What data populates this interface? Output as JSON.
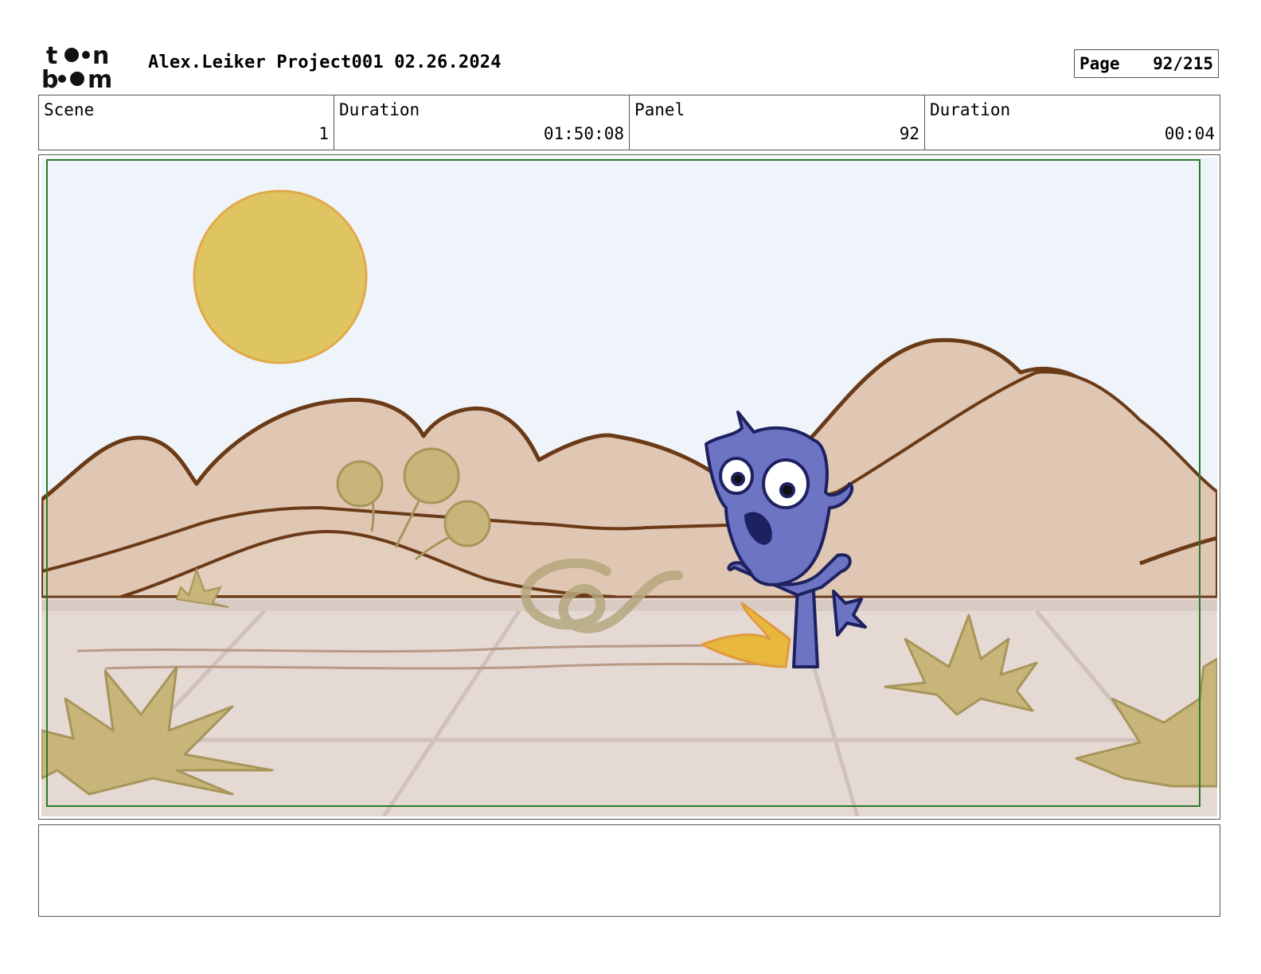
{
  "header": {
    "title": "Alex.Leiker Project001 02.26.2024",
    "page_label": "Page",
    "page_value": "92/215"
  },
  "logo": {
    "icon": "toon-boom-logo",
    "text_line1": "toon",
    "text_line2": "boom"
  },
  "info": {
    "scene_label": "Scene",
    "scene_value": "1",
    "scene_duration_label": "Duration",
    "scene_duration_value": "01:50:08",
    "panel_label": "Panel",
    "panel_value": "92",
    "panel_duration_label": "Duration",
    "panel_duration_value": "00:04"
  },
  "colors": {
    "sky": "#eef4fa",
    "sun": "#dfc462",
    "hills": "#e0c7b4",
    "hill_outline": "#6b3a17",
    "ground": "#e5d9d4",
    "bush": "#c8b57a",
    "character": "#6d74c4",
    "flame": "#e8b83e",
    "safe_frame": "#2b7a2b"
  },
  "notes": ""
}
